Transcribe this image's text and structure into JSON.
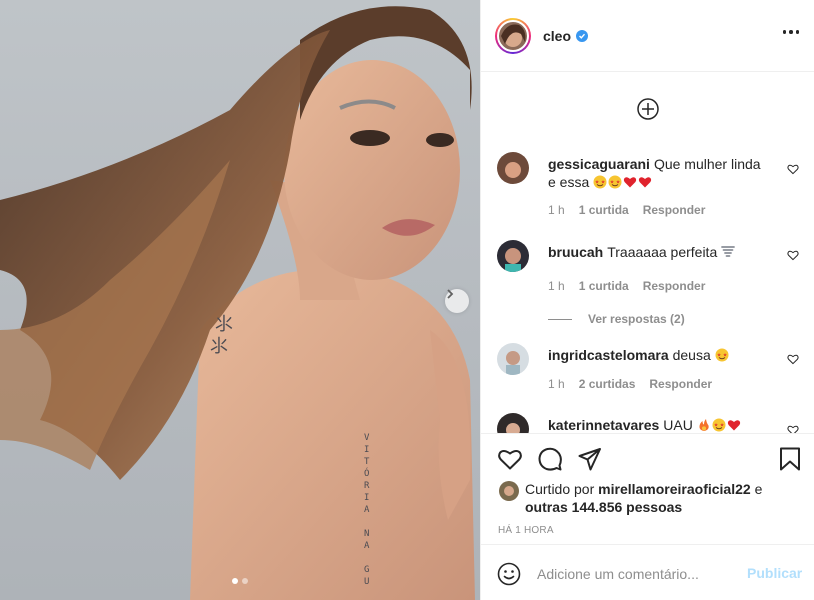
{
  "post": {
    "image_description": "",
    "carousel": {
      "slide_count": 2,
      "active_index": 0
    }
  },
  "header": {
    "username": "cleo",
    "verified": true,
    "verified_color": "#3897f0"
  },
  "comments": {
    "items": [
      {
        "username": "gessicaguarani",
        "text": "Que mulher linda e essa",
        "emojis": [
          "star-struck",
          "star-struck",
          "red-heart",
          "red-heart"
        ],
        "time": "1 h",
        "likes": "1 curtida",
        "reply_label": "Responder"
      },
      {
        "username": "bruucah",
        "text": "Traaaaaa perfeita",
        "emojis": [
          "tornado"
        ],
        "time": "1 h",
        "likes": "1 curtida",
        "reply_label": "Responder",
        "view_replies": "Ver respostas (2)"
      },
      {
        "username": "ingridcastelomara",
        "text": "deusa",
        "emojis": [
          "star-struck"
        ],
        "time": "1 h",
        "likes": "2 curtidas",
        "reply_label": "Responder"
      },
      {
        "username": "katerinnetavares",
        "text": "UAU",
        "emojis": [
          "fire",
          "star-struck",
          "red-heart"
        ]
      }
    ]
  },
  "actions": {
    "liked_by_prefix": "Curtido por",
    "liked_by_user": "mirellamoreiraoficial22",
    "liked_by_and": "e",
    "liked_by_others": "outras 144.856 pessoas",
    "timestamp": "Há 1 hora"
  },
  "add_comment": {
    "placeholder": "Adicione um comentário...",
    "publish_label": "Publicar",
    "publish_color": "#b2dffc"
  },
  "colors": {
    "text_primary": "#262626",
    "text_secondary": "#8e8e8e",
    "border": "#efefef",
    "like_red": "#ed4956"
  }
}
